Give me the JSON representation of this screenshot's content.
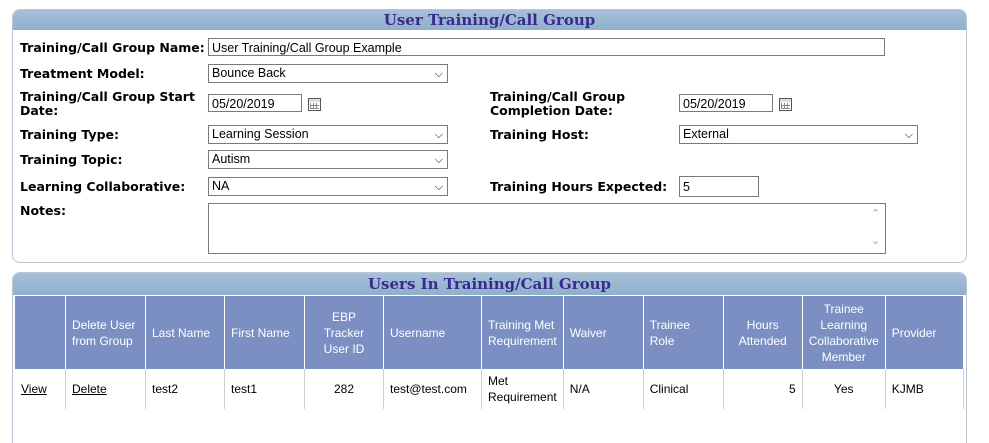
{
  "form": {
    "title": "User Training/Call Group",
    "group_name_label": "Training/Call Group Name:",
    "group_name_value": "User Training/Call Group Example",
    "treatment_model_label": "Treatment Model:",
    "treatment_model_value": "Bounce Back",
    "start_date_label": "Training/Call Group Start Date:",
    "start_date_value": "05/20/2019",
    "completion_date_label": "Training/Call Group Completion Date:",
    "completion_date_value": "05/20/2019",
    "training_type_label": "Training Type:",
    "training_type_value": "Learning Session",
    "training_host_label": "Training Host:",
    "training_host_value": "External",
    "training_topic_label": "Training Topic:",
    "training_topic_value": "Autism",
    "learning_collab_label": "Learning Collaborative:",
    "learning_collab_value": "NA",
    "hours_expected_label": "Training Hours Expected:",
    "hours_expected_value": "5",
    "notes_label": "Notes:",
    "notes_value": ""
  },
  "users": {
    "title": "Users In Training/Call Group",
    "columns": [
      "",
      "Delete User from Group",
      "Last Name",
      "First Name",
      "EBP Tracker User ID",
      "Username",
      "Training Met Requirement",
      "Waiver",
      "Trainee Role",
      "Hours Attended",
      "Trainee Learning Collaborative Member",
      "Provider"
    ],
    "rows": [
      {
        "view": "View",
        "delete": "Delete",
        "last_name": "test2",
        "first_name": "test1",
        "user_id": "282",
        "username": "test@test.com",
        "met_requirement": "Met Requirement",
        "waiver": "N/A",
        "role": "Clinical",
        "hours": "5",
        "collab_member": "Yes",
        "provider": "KJMB"
      }
    ]
  },
  "icons": {
    "calendar": "calendar-icon",
    "dropdown": "chevron-down-icon"
  },
  "colors": {
    "header_band": "#9ab8d3",
    "header_text": "#3a2a8c",
    "table_header": "#7b8fc2"
  }
}
